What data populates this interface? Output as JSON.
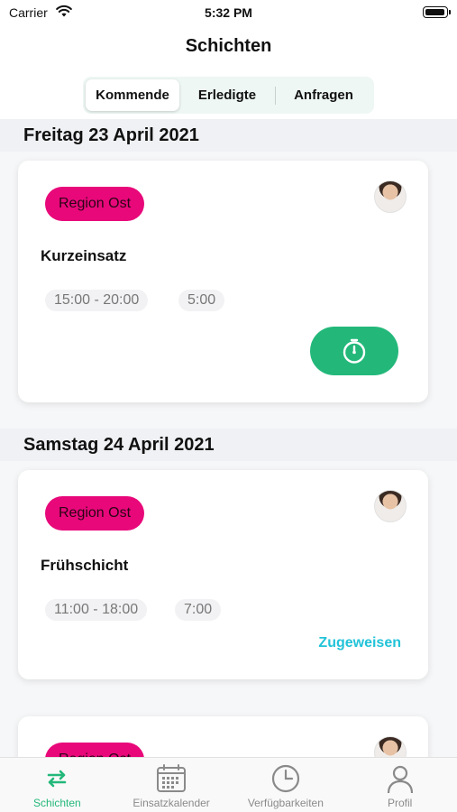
{
  "status_bar": {
    "carrier": "Carrier",
    "time": "5:32 PM"
  },
  "nav": {
    "title": "Schichten"
  },
  "segments": [
    {
      "label": "Kommende",
      "active": true
    },
    {
      "label": "Erledigte",
      "active": false
    },
    {
      "label": "Anfragen",
      "active": false
    }
  ],
  "sections": [
    {
      "date": "Freitag 23 April 2021",
      "shift": {
        "region": "Region Ost",
        "title": "Kurzeinsatz",
        "time_range": "15:00 - 20:00",
        "duration": "5:00",
        "action": "timer"
      }
    },
    {
      "date": "Samstag 24 April 2021",
      "shift": {
        "region": "Region Ost",
        "title": "Frühschicht",
        "time_range": "11:00 - 18:00",
        "duration": "7:00",
        "action_label": "Zugeweisen"
      }
    },
    {
      "shift": {
        "region": "Region Ost"
      }
    }
  ],
  "tab_bar": [
    {
      "label": "Schichten",
      "icon": "swap-arrows-icon",
      "active": true
    },
    {
      "label": "Einsatzkalender",
      "icon": "calendar-icon",
      "active": false
    },
    {
      "label": "Verfügbarkeiten",
      "icon": "clock-icon",
      "active": false
    },
    {
      "label": "Profil",
      "icon": "person-icon",
      "active": false
    }
  ],
  "colors": {
    "accent": "#23b87a",
    "badge": "#e8087a",
    "link": "#22c3d8"
  }
}
